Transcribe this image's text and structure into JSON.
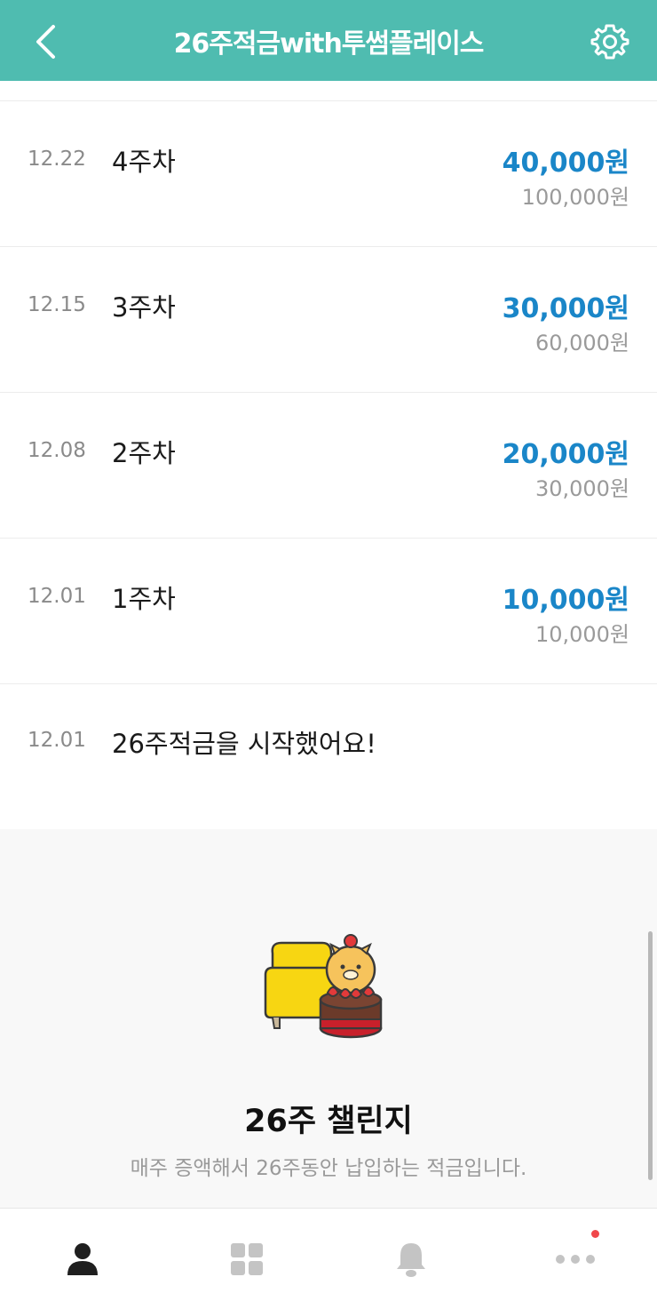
{
  "header": {
    "title": "26주적금with투썸플레이스",
    "back_icon": "chevron-left-icon",
    "settings_icon": "gear-icon"
  },
  "history": [
    {
      "date": "12.22",
      "week": "4주차",
      "amount": "40,000원",
      "total": "100,000원"
    },
    {
      "date": "12.15",
      "week": "3주차",
      "amount": "30,000원",
      "total": "60,000원"
    },
    {
      "date": "12.08",
      "week": "2주차",
      "amount": "20,000원",
      "total": "30,000원"
    },
    {
      "date": "12.01",
      "week": "1주차",
      "amount": "10,000원",
      "total": "10,000원"
    }
  ],
  "start_event": {
    "date": "12.01",
    "text": "26주적금을 시작했어요!"
  },
  "challenge": {
    "title": "26주 챌린지",
    "description": "매주 증액해서 26주동안 납입하는 적금입니다."
  },
  "tabbar": {
    "tabs": [
      {
        "icon": "person-icon",
        "active": true
      },
      {
        "icon": "grid-icon",
        "active": false
      },
      {
        "icon": "bell-icon",
        "active": false
      },
      {
        "icon": "more-icon",
        "active": false,
        "badge": true
      }
    ]
  },
  "colors": {
    "header_bg": "#4fbcb0",
    "amount": "#1a86c8",
    "badge": "#f0474b"
  }
}
